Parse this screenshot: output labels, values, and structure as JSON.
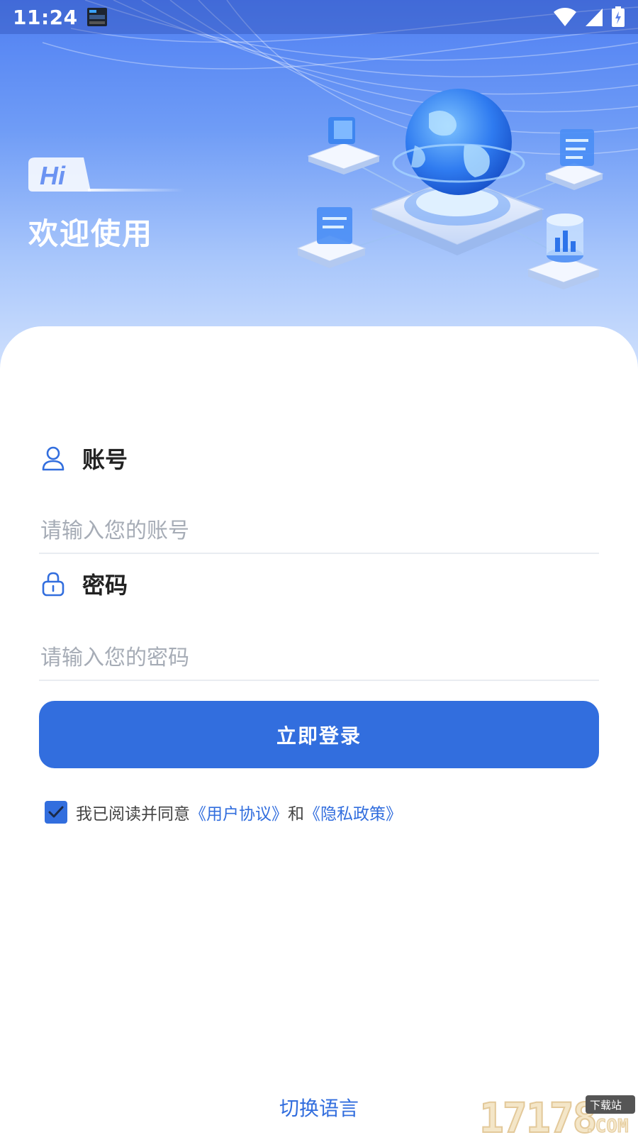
{
  "status_bar": {
    "time": "11:24",
    "icons": [
      "notification-app-icon",
      "wifi-icon",
      "signal-icon",
      "battery-charging-icon"
    ]
  },
  "hero": {
    "hi_badge": "Hi",
    "welcome_text": "欢迎使用",
    "illustration": "globe-network-illustration"
  },
  "form": {
    "account": {
      "label": "账号",
      "icon": "user-icon",
      "placeholder": "请输入您的账号",
      "value": ""
    },
    "password": {
      "label": "密码",
      "icon": "lock-icon",
      "placeholder": "请输入您的密码",
      "value": ""
    },
    "login_button": "立即登录"
  },
  "agreement": {
    "checked": true,
    "prefix": "我已阅读并同意",
    "user_agreement": "《用户协议》",
    "conjunction": "和",
    "privacy_policy": "《隐私政策》"
  },
  "switch_language": "切换语言",
  "watermark": {
    "text": "17178",
    "suffix": ".COM",
    "tag": "下载站"
  },
  "colors": {
    "primary": "#326ede",
    "hero_top": "#4f7ff2",
    "hero_bottom": "#cfe0fd",
    "placeholder": "#a6acb6",
    "divider": "#e9ecf1"
  }
}
